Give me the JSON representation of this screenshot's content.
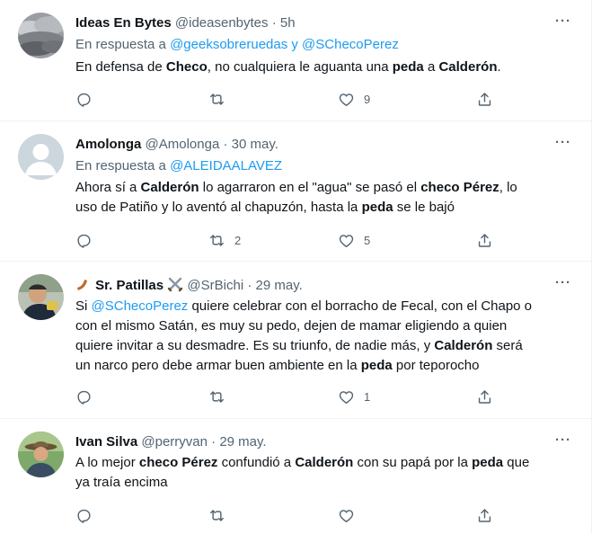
{
  "tweets": [
    {
      "name": "Ideas En Bytes",
      "handle": "@ideasenbytes",
      "dot": "·",
      "time": "5h",
      "reply_prefix": "En respuesta a",
      "reply_to": "@geeksobreruedas y @SChecoPerez",
      "text_parts": [
        "En defensa de ",
        "Checo",
        ", no cualquiera le aguanta una ",
        "peda",
        " a ",
        "Calderón",
        "."
      ],
      "replies": "",
      "retweets": "",
      "likes": "9"
    },
    {
      "name": "Amolonga",
      "handle": "@Amolonga",
      "dot": "·",
      "time": "30 may.",
      "reply_prefix": "En respuesta a",
      "reply_to": "@ALEIDAALAVEZ",
      "text_line1": [
        "Ahora sí a ",
        "Calderón",
        " lo agarraron en el \"agua\" se pasó el ",
        "checo Pérez",
        ", lo"
      ],
      "text_line2": [
        "uso de Patiño y lo aventó al chapuzón, hasta la ",
        "peda",
        " se le bajó"
      ],
      "replies": "",
      "retweets": "2",
      "likes": "5"
    },
    {
      "name_emoji_left": "🪃",
      "name": "Sr. Patillas",
      "name_emoji_right": "⚔️",
      "handle": "@SrBichi",
      "dot": "·",
      "time": "29 may.",
      "text_prefix": "Si ",
      "text_mention": "@SChecoPerez",
      "text_line1_rest": " quiere celebrar con el borracho de Fecal, con el Chapo o",
      "text_line2": "con el mismo Satán, es muy su pedo, dejen de mamar eligiendo a quien",
      "text_line3": [
        "quiere invitar a su desmadre. Es su triunfo, de nadie más, y ",
        "Calderón",
        " será"
      ],
      "text_line4": [
        "un narco pero debe armar buen ambiente en la ",
        "peda",
        " por teporocho"
      ],
      "replies": "",
      "retweets": "",
      "likes": "1"
    },
    {
      "name": "Ivan Silva",
      "handle": "@perryvan",
      "dot": "·",
      "time": "29 may.",
      "text_line1": [
        "A lo mejor ",
        "checo Pérez",
        " confundió a ",
        "Calderón",
        " con su papá por la ",
        "peda",
        " que"
      ],
      "text_line2": "ya traía encima",
      "replies": "",
      "retweets": "",
      "likes": ""
    }
  ],
  "icons": {
    "more": "more-dots-icon",
    "reply": "reply-bubble-icon",
    "retweet": "retweet-icon",
    "like": "heart-icon",
    "share": "share-upload-icon"
  },
  "colors": {
    "text": "#0f1419",
    "secondary": "#536471",
    "link": "#1d9bf0",
    "border": "#eff3f4"
  }
}
